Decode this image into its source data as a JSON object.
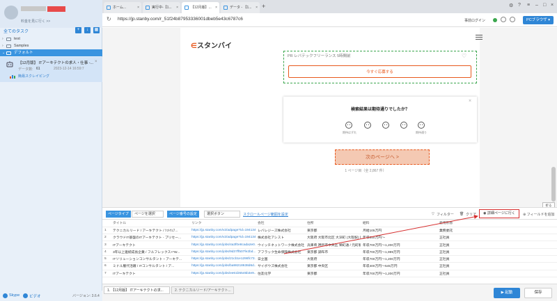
{
  "sidebar": {
    "user_sub": "料金を見に行く >>",
    "all_tasks": "全てのタスク",
    "folders": [
      {
        "label": "test"
      },
      {
        "label": "Samples"
      },
      {
        "label": "デフォルト"
      }
    ],
    "task": {
      "title": "【12月版】 ITアーキテクトの求人・仕事 -...",
      "meta_label": "データ数:",
      "meta_count": "61",
      "date": "2023-12-14 16:59:7",
      "mode": "簡易スクレイピング"
    },
    "footer": {
      "skype": "Skype",
      "video": "ビデオ",
      "version": "バージョン: 3.6.4"
    }
  },
  "browser": {
    "tabs": [
      {
        "label": "ホーム..."
      },
      {
        "label": "実行中-【1..."
      },
      {
        "label": "【12月版】..."
      },
      {
        "label": "データ - 【1..."
      }
    ],
    "url": "https://jp.stanby.com/r_51f24b87953336001dbeb5e43c6787c6",
    "login_link": "事前ログイン",
    "pc_browser": "PCブラウザ ▾"
  },
  "page": {
    "logo": "スタンバイ",
    "job_pr": "PR  レバテックフリーランス  5時間前",
    "apply_button": "今すぐ応募する",
    "survey_title": "検索結果は期待通りでしたか？",
    "survey_low": "期待はずれ",
    "survey_high": "期待通り",
    "next_button": "次のページへ  >",
    "page_info": "1 ページ目（全 2,867 件）",
    "collapse": "折る"
  },
  "toolbar": {
    "page_type_label": "ページタイプ",
    "page_type_value": "ページを選択",
    "page_num_label": "ページ番号の設定",
    "page_num_value": "選択ボタン",
    "scroll_link": "スクロールページ範囲を設定",
    "filter": "フィルター",
    "clear": "クリア",
    "detail_button": "詳細ページに行く",
    "add_field": "フィールドを追加"
  },
  "table": {
    "headers": [
      "タイトル",
      "リンク",
      "会社",
      "住所",
      "給料",
      "雇用形態"
    ],
    "rows": [
      [
        "1",
        "テクニカルリード / アーキテクト / ｿﾌﾄｳｪｱ...",
        "https://jp.stanby.com/v2/adpage?id=194134...",
        "レバレジーズ株式会社",
        "東京都",
        "月給105万円",
        "業務委託"
      ],
      [
        "2",
        "クラウドIT基盤のITアーキテクト - プリセー...",
        "https://jp.stanby.com/v2/adpage?id=194134...",
        "株式会社アシスト",
        "大阪府 大阪市北区 大深町 (大阪駅) 徒歩4分",
        "年収850万円～",
        "正社員"
      ],
      [
        "3",
        "ITアーキテクト",
        "https://jp.stanby.com/jobs/4a3f0e8cada2e0...",
        "ウイッチネットワーク株式会社",
        "兵庫県 神戸市中央区 栄町通 / 元町駅 徒歩4分",
        "年収700万円～1,200万円",
        "正社員"
      ],
      [
        "4",
        "3年以上連続成長企業 / フルフレックス×*W...",
        "https://jp.stanby.com/jobs/9d37ff507fe2bd...",
        "アフラック生命保険株式会社",
        "東京都 調布市",
        "年収700万円～1,999万円",
        "正社員"
      ],
      [
        "5",
        "ITソリューションコンサルタント・アーキテ...",
        "https://jp.stanby.com/jobs/21cb1e1298fc73...",
        "日立国",
        "大阪府",
        "年収700万円～1,200万円",
        "正社員"
      ],
      [
        "6",
        "ミドル層代活躍 / ITコンサルタント / ア...",
        "https://jp.stanby.com/jobs/ba98218638d6d...",
        "サイボウズ株式会社",
        "東京都 中央区",
        "年収400万円～545万円",
        "正社員"
      ],
      [
        "7",
        "ITアーキテクト",
        "https://jp.stanby.com/jobs/ee61b5545b3e9...",
        "住友化学",
        "東京都",
        "年収700万円～1,200万円",
        "正社員"
      ]
    ]
  },
  "bottom": {
    "tab1": "1. 【12月版】 ITアーキテクトの求...",
    "tab2": "2. テクニカルリード/アーキテクト...",
    "run": "▶ 起動",
    "save": "保存"
  },
  "colors": {
    "accent": "#2f86d6",
    "brand_orange": "#e8581c",
    "annotation_red": "#d62d2d"
  }
}
